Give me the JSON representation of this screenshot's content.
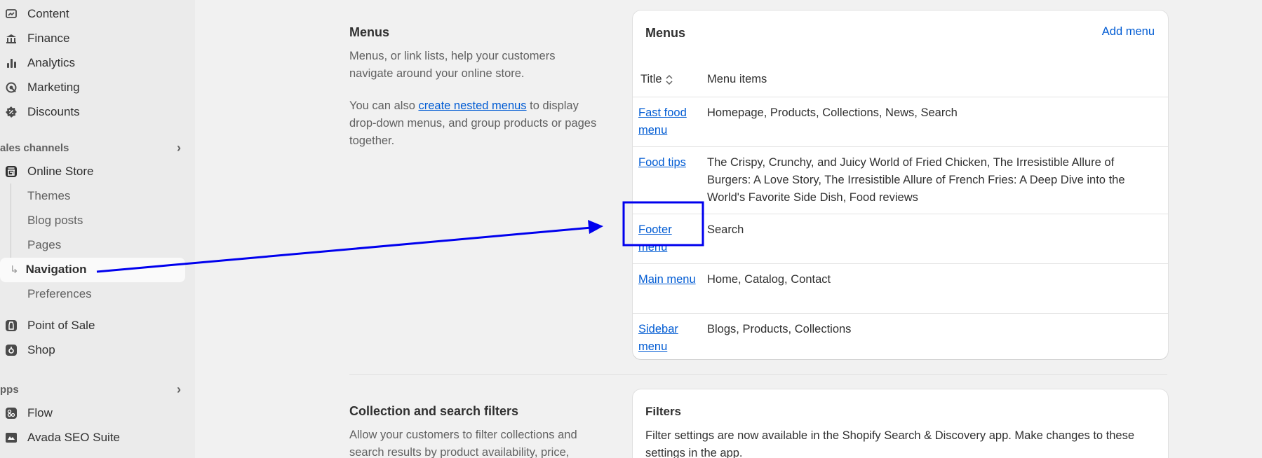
{
  "sidebar": {
    "items_top": [
      {
        "label": "Content",
        "icon": "content-icon"
      },
      {
        "label": "Finance",
        "icon": "finance-icon"
      },
      {
        "label": "Analytics",
        "icon": "analytics-icon"
      },
      {
        "label": "Marketing",
        "icon": "marketing-icon"
      },
      {
        "label": "Discounts",
        "icon": "discounts-icon"
      }
    ],
    "sales_channels_header": "ales channels",
    "online_store": {
      "label": "Online Store",
      "icon": "store-icon"
    },
    "online_store_sub": [
      "Themes",
      "Blog posts",
      "Pages",
      "Navigation",
      "Preferences"
    ],
    "active_sub": "Navigation",
    "channels": [
      {
        "label": "Point of Sale",
        "icon": "pos-icon"
      },
      {
        "label": "Shop",
        "icon": "shop-icon"
      }
    ],
    "apps_header": "pps",
    "apps": [
      {
        "label": "Flow",
        "icon": "flow-icon"
      },
      {
        "label": "Avada SEO Suite",
        "icon": "avada-icon"
      }
    ]
  },
  "menus_section": {
    "title": "Menus",
    "desc1": "Menus, or link lists, help your customers navigate around your online store.",
    "desc2_pre": "You can also ",
    "desc2_link": "create nested menus",
    "desc2_post": " to display drop-down menus, and group products or pages together."
  },
  "menus_card": {
    "title": "Menus",
    "add_label": "Add menu",
    "col_title": "Title",
    "col_items": "Menu items",
    "rows": [
      {
        "title": "Fast food menu",
        "items": "Homepage, Products, Collections, News, Search"
      },
      {
        "title": "Food tips",
        "items": "The Crispy, Crunchy, and Juicy World of Fried Chicken, The Irresistible Allure of Burgers: A Love Story, The Irresistible Allure of French Fries: A Deep Dive into the World's Favorite Side Dish, Food reviews"
      },
      {
        "title": "Footer menu",
        "items": "Search"
      },
      {
        "title": "Main menu",
        "items": "Home, Catalog, Contact"
      },
      {
        "title": "Sidebar menu",
        "items": "Blogs, Products, Collections"
      }
    ]
  },
  "filters_section": {
    "title": "Collection and search filters",
    "desc": "Allow your customers to filter collections and search results by product availability, price,"
  },
  "filters_card": {
    "title": "Filters",
    "body": "Filter settings are now available in the Shopify Search & Discovery app. Make changes to these settings in the app."
  },
  "colors": {
    "link": "#005bd3",
    "annotation": "#0000ee"
  }
}
